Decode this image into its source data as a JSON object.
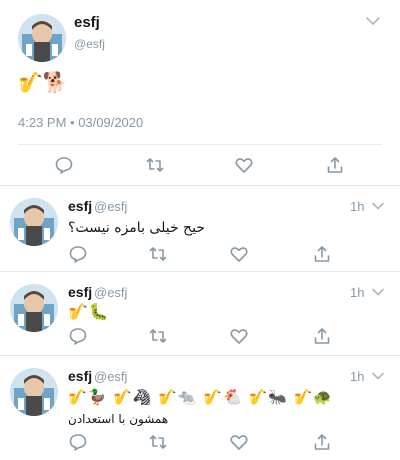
{
  "main_tweet": {
    "name": "esfj",
    "handle": "@esfj",
    "body": "🎷🐕",
    "timestamp": "4:23 PM • 03/09/2020",
    "icons": [
      "comment-icon",
      "retweet-icon",
      "like-icon",
      "share-icon",
      "chevron-down-icon"
    ]
  },
  "replies": [
    {
      "name": "esfj",
      "handle": "@esfj",
      "ago": "1h",
      "text": "حیح خیلی بامزه نیست؟"
    },
    {
      "name": "esfj",
      "handle": "@esfj",
      "ago": "1h",
      "text": "🎷🐛"
    },
    {
      "name": "esfj",
      "handle": "@esfj",
      "ago": "1h",
      "text": "🎷🦆 🎷🦓 🎷🐀 🎷🐔 🎷🐜 🎷🐢",
      "subtext": "همشون با استعدادن"
    }
  ],
  "colors": {
    "muted": "#8899a6",
    "text": "#14171a",
    "border": "#e1e8ed"
  }
}
